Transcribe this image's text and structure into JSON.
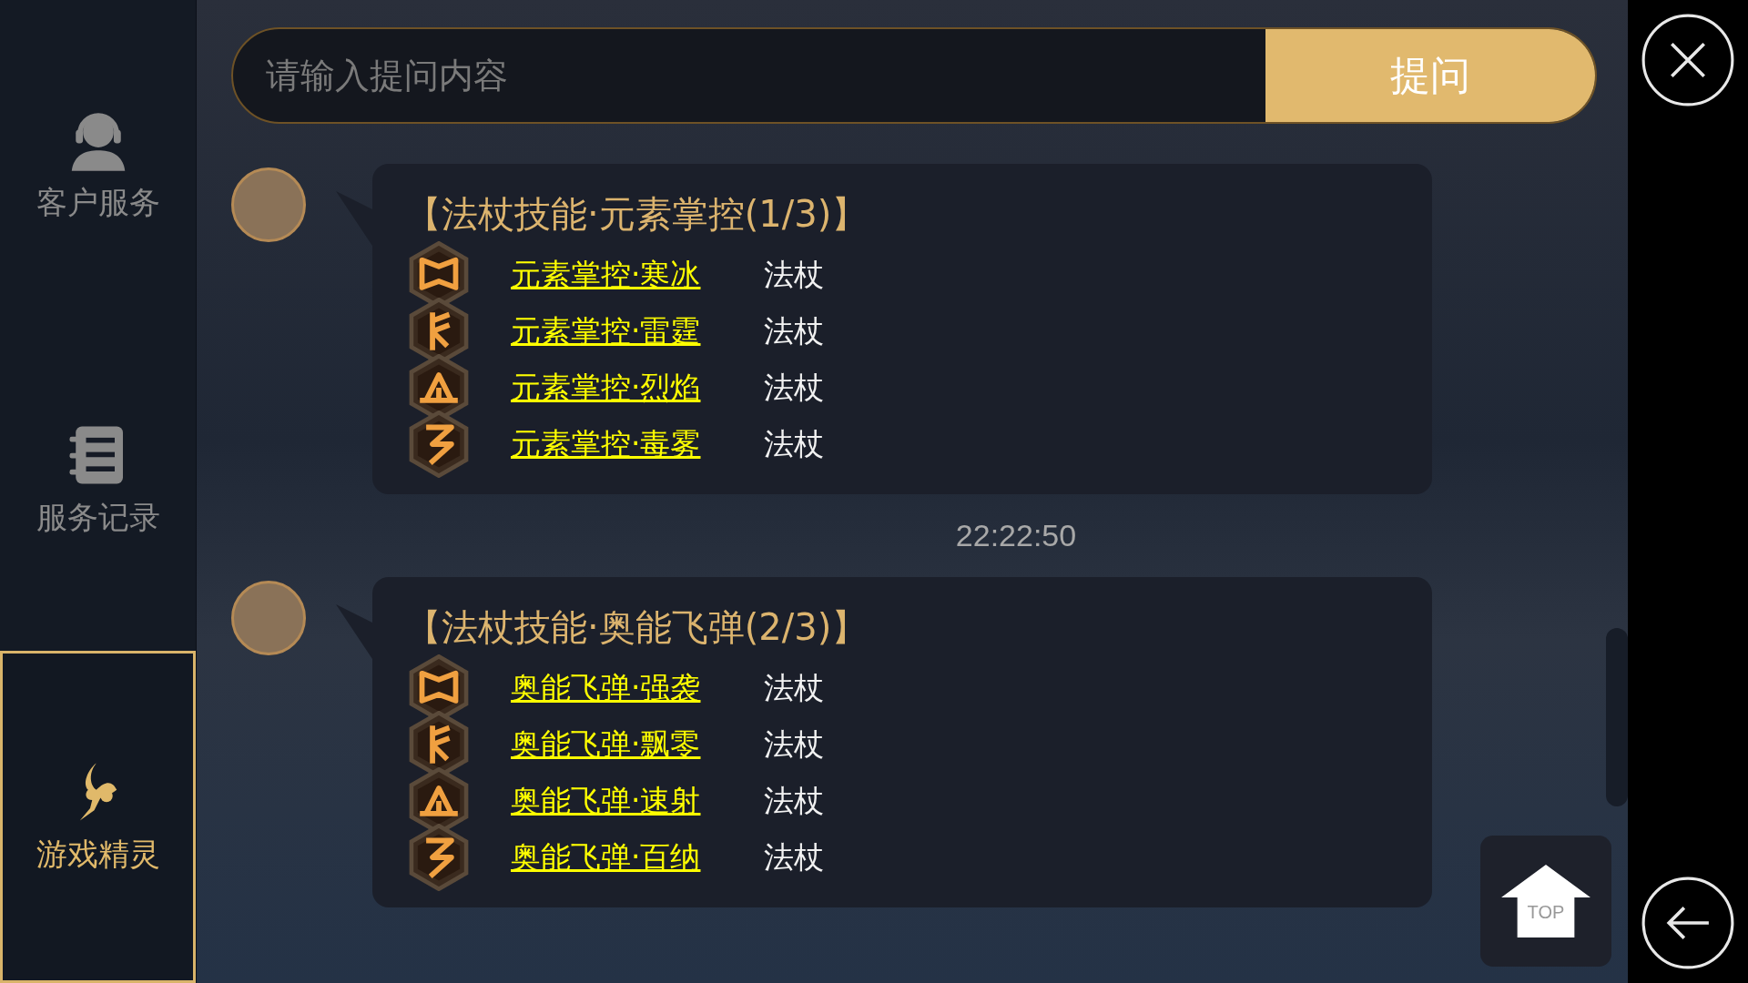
{
  "sidebar": {
    "items": [
      {
        "kind": "headset",
        "label": "客户服务",
        "selected": false
      },
      {
        "kind": "notebook",
        "label": "服务记录",
        "selected": false
      },
      {
        "kind": "fairy",
        "label": "游戏精灵",
        "selected": true
      }
    ]
  },
  "search": {
    "placeholder": "请输入提问内容",
    "button": "提问"
  },
  "chat": [
    {
      "kind": "message",
      "title": "【法杖技能·元素掌控(1/3)】",
      "skills": [
        {
          "name": "元素掌控·寒冰",
          "weapon": "法杖"
        },
        {
          "name": "元素掌控·雷霆",
          "weapon": "法杖"
        },
        {
          "name": "元素掌控·烈焰",
          "weapon": "法杖"
        },
        {
          "name": "元素掌控·毒雾",
          "weapon": "法杖"
        }
      ]
    },
    {
      "kind": "time",
      "text": "22:22:50"
    },
    {
      "kind": "message",
      "title": "【法杖技能·奥能飞弹(2/3)】",
      "skills": [
        {
          "name": "奥能飞弹·强袭",
          "weapon": "法杖"
        },
        {
          "name": "奥能飞弹·飘零",
          "weapon": "法杖"
        },
        {
          "name": "奥能飞弹·速射",
          "weapon": "法杖"
        },
        {
          "name": "奥能飞弹·百纳",
          "weapon": "法杖"
        }
      ]
    }
  ],
  "top_button": {
    "label": "TOP"
  }
}
